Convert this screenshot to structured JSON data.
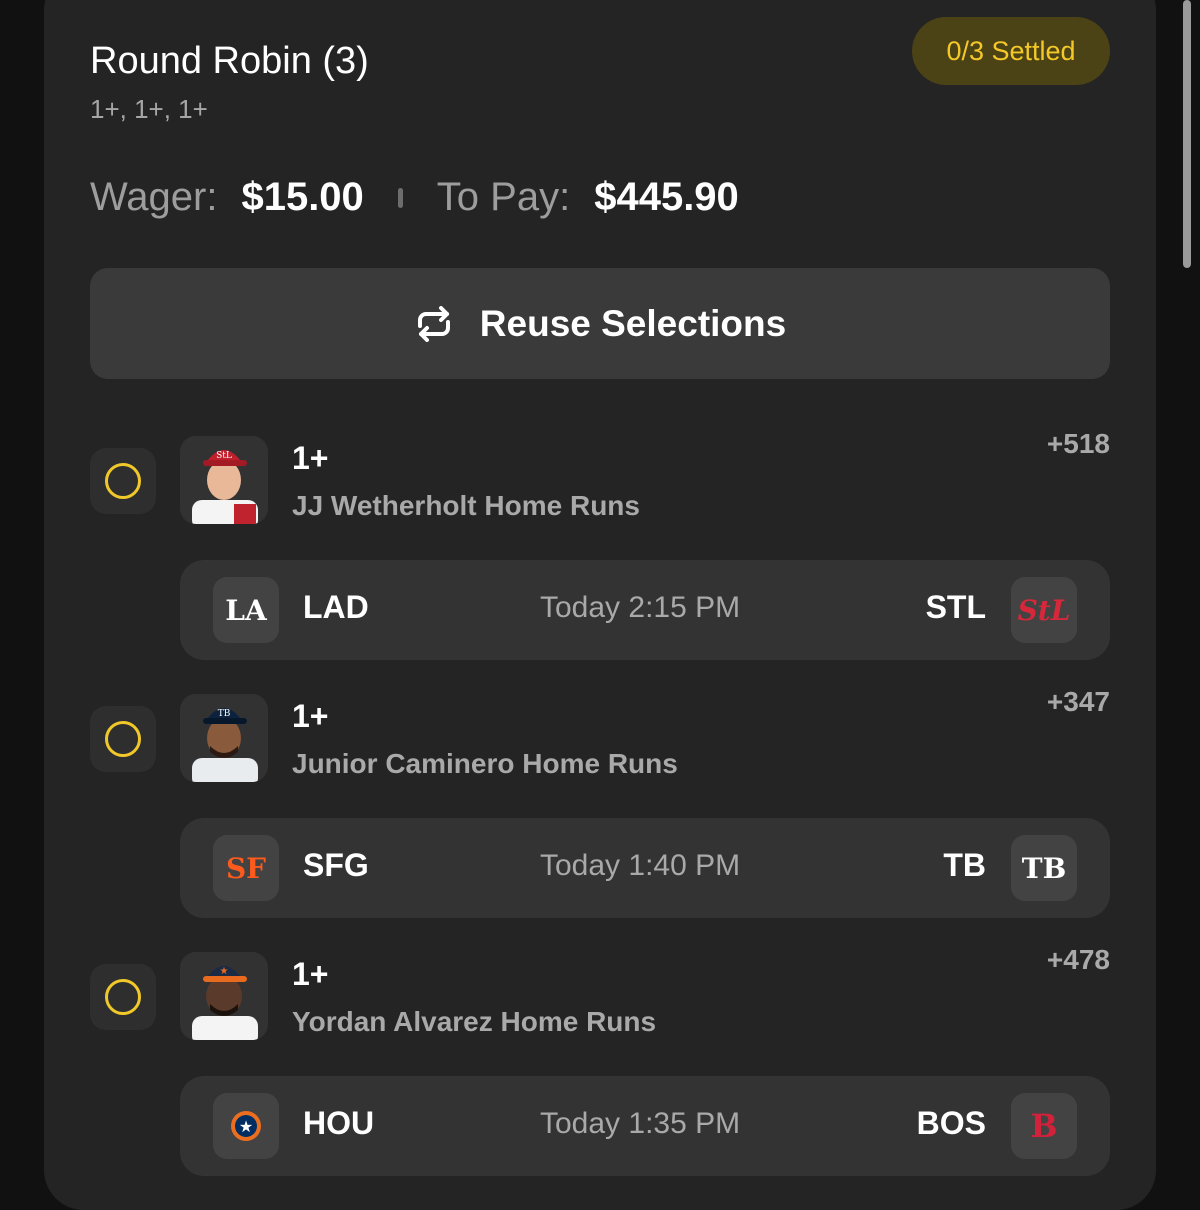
{
  "header": {
    "title": "Round Robin (3)",
    "subtitle": "1+, 1+, 1+",
    "status_badge": "0/3 Settled"
  },
  "wager": {
    "wager_label": "Wager:",
    "wager_value": "$15.00",
    "to_pay_label": "To Pay:",
    "to_pay_value": "$445.90"
  },
  "reuse_button": {
    "label": "Reuse Selections",
    "icon": "repeat-icon"
  },
  "legs": [
    {
      "line": "1+",
      "description": "JJ Wetherholt Home Runs",
      "odds": "+518",
      "away_team": "LAD",
      "home_team": "STL",
      "time": "Today 2:15 PM",
      "away_logo": "dodgers-logo",
      "home_logo": "cardinals-logo"
    },
    {
      "line": "1+",
      "description": "Junior Caminero Home Runs",
      "odds": "+347",
      "away_team": "SFG",
      "home_team": "TB",
      "time": "Today 1:40 PM",
      "away_logo": "giants-logo",
      "home_logo": "rays-logo"
    },
    {
      "line": "1+",
      "description": "Yordan Alvarez Home Runs",
      "odds": "+478",
      "away_team": "HOU",
      "home_team": "BOS",
      "time": "Today 1:35 PM",
      "away_logo": "astros-logo",
      "home_logo": "red-sox-logo"
    }
  ],
  "colors": {
    "accent_yellow": "#f1c82a",
    "badge_bg": "#4b4216",
    "card_bg": "#242424",
    "page_bg": "#111111"
  }
}
